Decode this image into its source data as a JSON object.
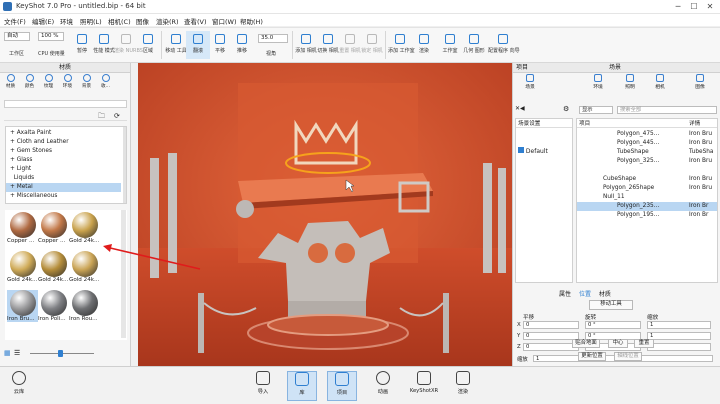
{
  "window": {
    "title": "KeyShot 7.0 Pro - untitled.bip - 64 bit",
    "min": "─",
    "max": "☐",
    "close": "✕"
  },
  "menu": [
    "文件(F)",
    "编辑(E)",
    "环境",
    "照明(L)",
    "相机(C)",
    "图像",
    "渲染(R)",
    "查看(V)",
    "窗口(W)",
    "帮助(H)"
  ],
  "toolbar": {
    "mode_value": "自动",
    "zoom_value": "100 %",
    "workspace_label": "工作区",
    "cpu_label": "CPU 使用量",
    "pause_label": "暂停",
    "perf_label": "性能\n模式",
    "denoise_label": "渲染\nNURBS",
    "region_label": "区域",
    "move_tool_label": "移动\n工具",
    "tumble_label": "翻滚",
    "pan_label": "平移",
    "dolly_label": "推移",
    "fov_value": "35.0",
    "view_label": "视角",
    "add_camera_label": "添加\n相机",
    "switch_camera_label": "切换\n相机",
    "reset_camera_label": "重置\n相机",
    "lock_camera_label": "锁定\n相机",
    "add_geometry_label": "添加\n工作室",
    "geometry_label": "几何\n图形",
    "config_label": "配置程序\n向导",
    "render_label": "渲染",
    "workspace_right_label": "工作室",
    "key_label": "关键\n帧"
  },
  "library": {
    "header": "材质",
    "tabs": [
      "材质",
      "颜色",
      "纹理",
      "环境",
      "背景",
      "收..."
    ],
    "tree": [
      "Axalta Paint",
      "Cloth and Leather",
      "Gem Stones",
      "Glass",
      "Light",
      "Liquids",
      "Metal",
      "Miscellaneous"
    ],
    "selected_tree_item": "Metal",
    "thumbs": [
      {
        "label": "Copper ...",
        "color": "#b06a42"
      },
      {
        "label": "Copper ...",
        "color": "#c27848"
      },
      {
        "label": "Gold 24k...",
        "color": "#c9a24c"
      },
      {
        "label": "Gold 24k...",
        "color": "#d0ab58"
      },
      {
        "label": "Gold 24k...",
        "color": "#b58d3a"
      },
      {
        "label": "Gold 24k...",
        "color": "#caa455"
      },
      {
        "label": "Iron Bru...",
        "color": "#9a9a9c"
      },
      {
        "label": "Iron Poli...",
        "color": "#7f8084"
      },
      {
        "label": "Iron Rou...",
        "color": "#6e6f72"
      }
    ]
  },
  "scene": {
    "header_left": "项目",
    "header_right": "场景",
    "tabs": [
      "场景",
      "环境",
      "照明",
      "相机",
      "图像"
    ],
    "filter_value": "显示",
    "search_placeholder": "搜索全部",
    "settings_col": "场景设置",
    "item_col": "项目",
    "detail_col": "详情",
    "default_label": "Default",
    "rows": [
      {
        "name": "Polygon_475...",
        "detail": "Iron Bru",
        "indent": 3
      },
      {
        "name": "Polygon_445...",
        "detail": "Iron Bru",
        "indent": 3
      },
      {
        "name": "TubeShape",
        "detail": "TubeSha",
        "indent": 3
      },
      {
        "name": "Polygon_325...",
        "detail": "Iron Bru",
        "indent": 3
      },
      {
        "name": "CubeShape",
        "detail": "Iron Bru",
        "indent": 2
      },
      {
        "name": "Polygon_265hape",
        "detail": "Iron Bru",
        "indent": 2
      },
      {
        "name": "Null_11",
        "detail": "",
        "indent": 2
      },
      {
        "name": "Polygon_235...",
        "detail": "Iron Br",
        "indent": 3
      },
      {
        "name": "Polygon_195...",
        "detail": "Iron Br",
        "indent": 3
      }
    ],
    "selected_row": 7,
    "prop_tabs": [
      "属性",
      "位置",
      "材质"
    ],
    "move_tool": "移动工具",
    "translate_label": "平移",
    "rotate_label": "旋转",
    "scale_label": "缩放",
    "axes": [
      "X",
      "Y",
      "Z"
    ],
    "translate_values": [
      "0",
      "0",
      "0"
    ],
    "rotate_values": [
      "0 °",
      "0 °",
      "0 °"
    ],
    "scale_values": [
      "1",
      "1",
      "1"
    ],
    "uniform_label": "缩放",
    "uniform_value": "1",
    "snap_button": "贴合地面",
    "center_button": "中心",
    "reset_button": "重置",
    "update_button": "更新位置",
    "pivot_button": "轴线位置"
  },
  "bottom": {
    "cloud_label": "云库",
    "buttons": [
      "导入",
      "库",
      "项目",
      "动画",
      "KeyShotXR",
      "渲染"
    ],
    "active": "库"
  },
  "colors": {
    "accent": "#2f7fd0",
    "viewport": "#d9522e",
    "selection": "#b9d6f2",
    "arrow": "#e01b1b"
  }
}
